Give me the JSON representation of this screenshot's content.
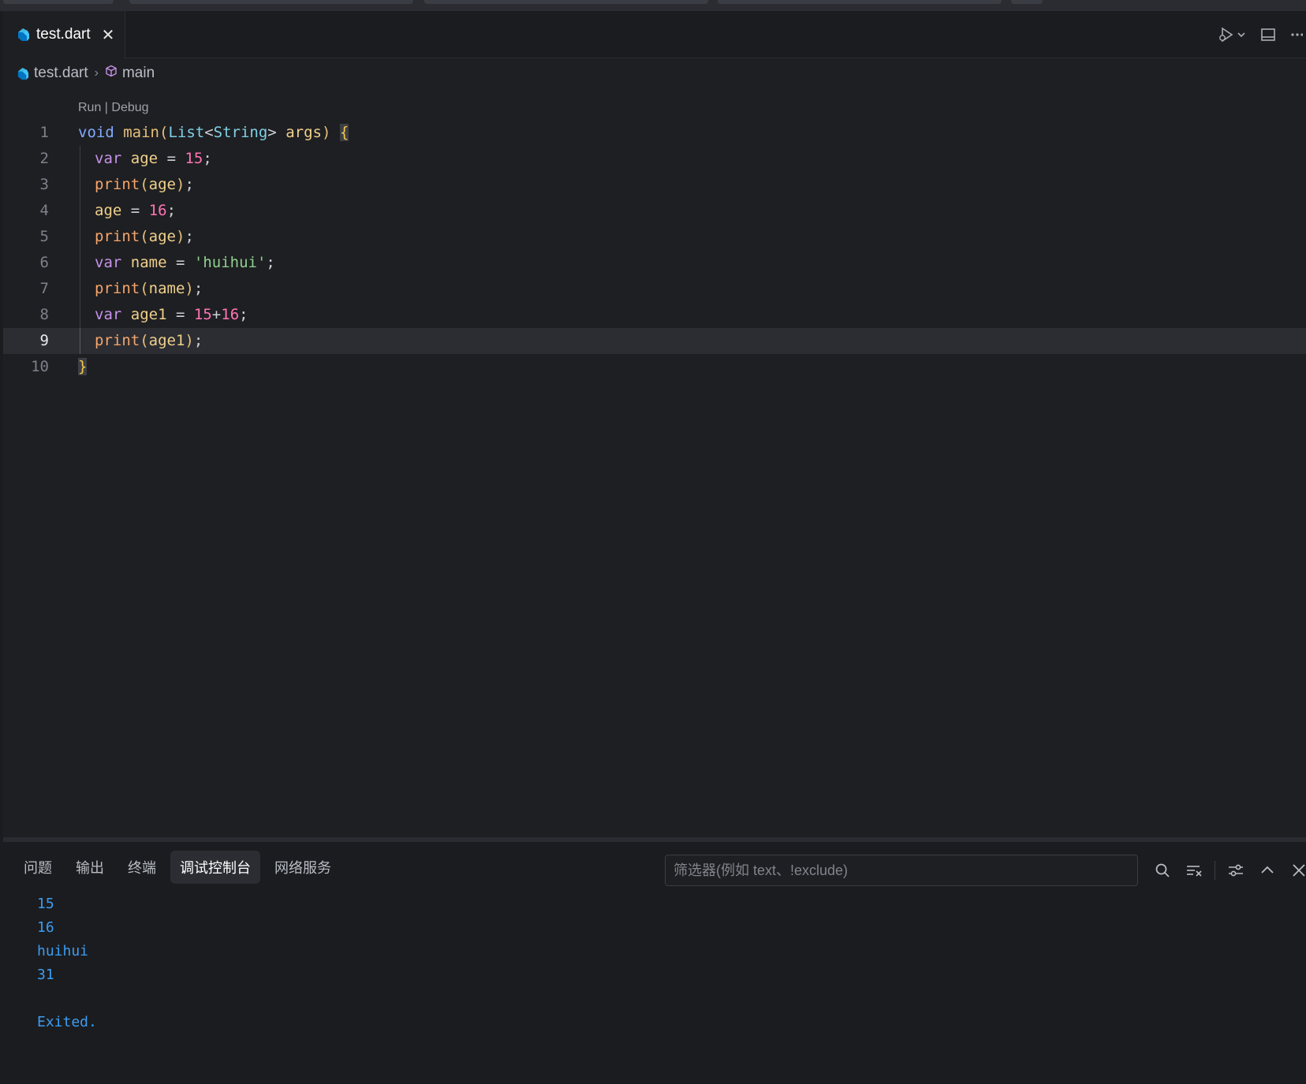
{
  "tab": {
    "filename": "test.dart",
    "close_glyph": "✕"
  },
  "breadcrumb": {
    "file": "test.dart",
    "symbol": "main"
  },
  "codelens": {
    "run": "Run",
    "separator": " | ",
    "debug": "Debug"
  },
  "code_lines": [
    {
      "n": "1",
      "text": "void main(List<String> args) {"
    },
    {
      "n": "2",
      "text": "var age = 15;"
    },
    {
      "n": "3",
      "text": "print(age);"
    },
    {
      "n": "4",
      "text": "age = 16;"
    },
    {
      "n": "5",
      "text": "print(age);"
    },
    {
      "n": "6",
      "text": "var name = 'huihui';"
    },
    {
      "n": "7",
      "text": "print(name);"
    },
    {
      "n": "8",
      "text": "var age1 = 15+16;"
    },
    {
      "n": "9",
      "text": "print(age1);"
    },
    {
      "n": "10",
      "text": "}"
    }
  ],
  "active_line": "9",
  "panel": {
    "tabs": [
      "问题",
      "输出",
      "终端",
      "调试控制台",
      "网络服务"
    ],
    "active_tab": "调试控制台",
    "filter_placeholder": "筛选器(例如 text、!exclude)"
  },
  "console_output": [
    "15",
    "16",
    "huihui",
    "31",
    "",
    "Exited."
  ],
  "icons": {
    "tab_file": "dart-icon",
    "breadcrumb_file": "dart-icon",
    "breadcrumb_symbol": "cube-icon",
    "run_debug": "run-debug-icon",
    "split": "split-editor-icon",
    "more": "more-icon",
    "search": "search-icon",
    "clear": "clear-console-icon",
    "settings": "filter-settings-icon",
    "maximize": "chevron-up-icon",
    "close": "close-icon"
  },
  "colors": {
    "console_text": "#3c9cf2",
    "keyword": "#c792ea",
    "number": "#ff75b5",
    "string": "#8fd18f"
  }
}
